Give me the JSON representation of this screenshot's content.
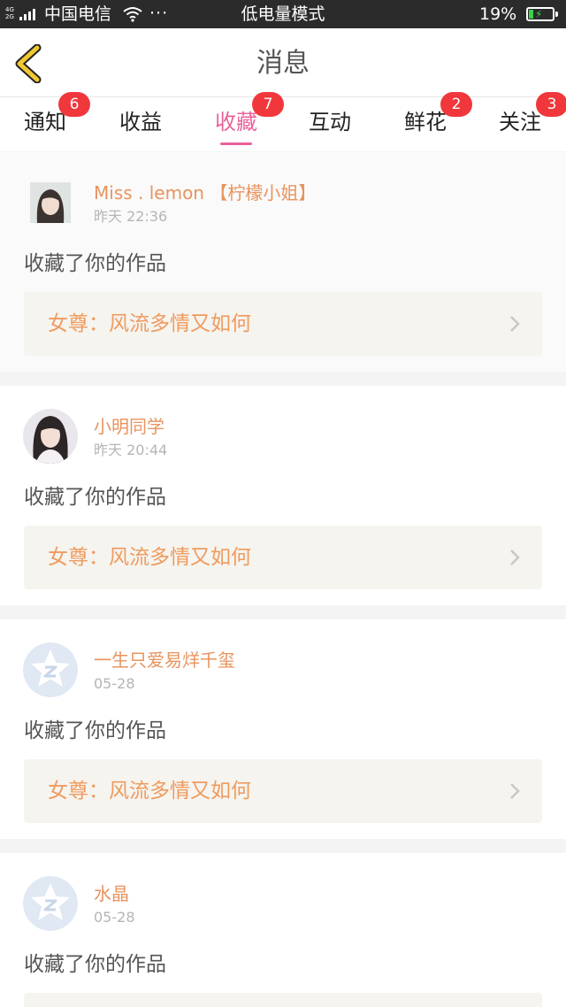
{
  "status_bar": {
    "network": "4G 2G",
    "carrier": "中国电信",
    "more": "···",
    "mode": "低电量模式",
    "battery_percent": "19%",
    "battery_level": 0.19
  },
  "header": {
    "title": "消息"
  },
  "tabs": [
    {
      "label": "通知",
      "badge": "6"
    },
    {
      "label": "收益",
      "badge": ""
    },
    {
      "label": "收藏",
      "badge": "7",
      "active": true
    },
    {
      "label": "互动",
      "badge": ""
    },
    {
      "label": "鲜花",
      "badge": "2"
    },
    {
      "label": "关注",
      "badge": "3"
    }
  ],
  "messages": [
    {
      "user": "Miss . lemon 【柠檬小姐】",
      "time": "昨天 22:36",
      "action": "收藏了你的作品",
      "work": "女尊：风流多情又如何",
      "avatar": "photo-girl-icon"
    },
    {
      "user": "小明同学",
      "time": "昨天 20:44",
      "action": "收藏了你的作品",
      "work": "女尊：风流多情又如何",
      "avatar": "photo-girl-icon"
    },
    {
      "user": "一生只爱易烊千玺",
      "time": "05-28",
      "action": "收藏了你的作品",
      "work": "女尊：风流多情又如何",
      "avatar": "default-star-avatar-icon"
    },
    {
      "user": "水晶",
      "time": "05-28",
      "action": "收藏了你的作品",
      "work": "",
      "avatar": "default-star-avatar-icon"
    }
  ],
  "colors": {
    "accent_pink": "#e8639a",
    "username_orange": "#e8935e",
    "badge_red": "#f0383c",
    "back_yellow": "#f0c832"
  }
}
